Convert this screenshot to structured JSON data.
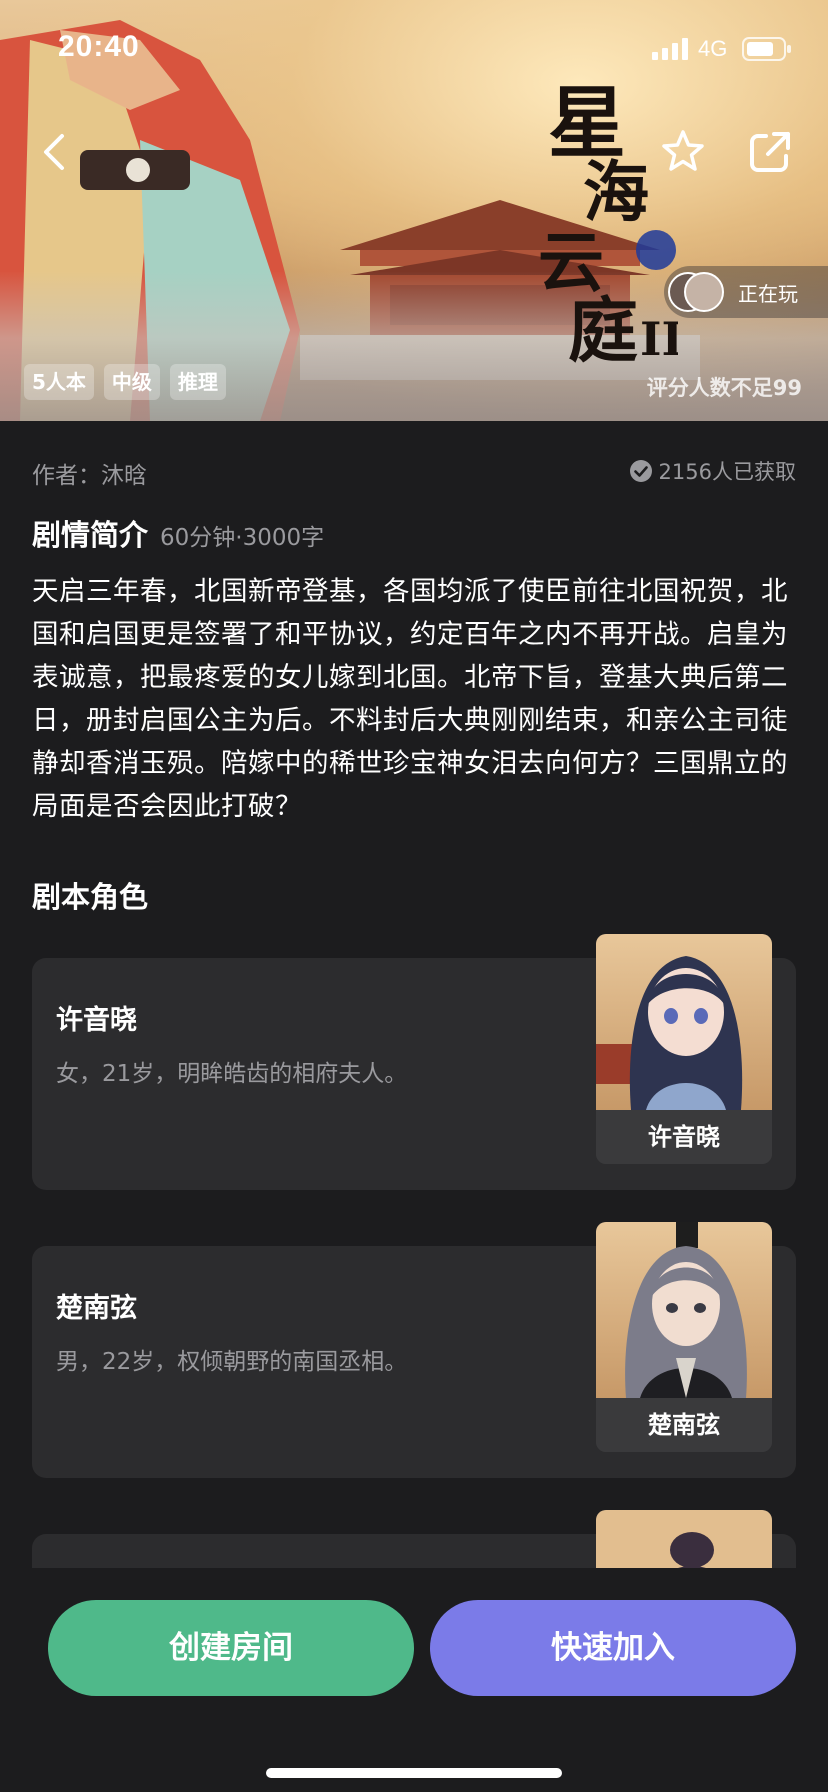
{
  "status_bar": {
    "time": "20:40",
    "network": "4G"
  },
  "header": {
    "back_icon": "chevron-left-icon",
    "favorite_icon": "star-outline-icon",
    "share_icon": "share-external-icon",
    "title_art": "星海云庭II",
    "now_playing_label": "正在玩",
    "tags": [
      "5人本",
      "中级",
      "推理"
    ],
    "rating_note": "评分人数不足99"
  },
  "info": {
    "author": "作者：沐晗",
    "obtained_count": "2156人已获取",
    "synopsis_title": "剧情简介",
    "synopsis_meta": "60分钟·3000字",
    "synopsis_text": "天启三年春，北国新帝登基，各国均派了使臣前往北国祝贺，北国和启国更是签署了和平协议，约定百年之内不再开战。启皇为表诚意，把最疼爱的女儿嫁到北国。北帝下旨，登基大典后第二日，册封启国公主为后。不料封后大典刚刚结束，和亲公主司徒静却香消玉殒。陪嫁中的稀世珍宝神女泪去向何方？三国鼎立的局面是否会因此打破？",
    "roles_title": "剧本角色"
  },
  "roles": [
    {
      "name": "许音晓",
      "desc": "女，21岁，明眸皓齿的相府夫人。",
      "caption": "许音晓"
    },
    {
      "name": "楚南弦",
      "desc": "男，22岁，权倾朝野的南国丞相。",
      "caption": "楚南弦"
    }
  ],
  "actions": {
    "create_room": "创建房间",
    "quick_join": "快速加入"
  },
  "colors": {
    "create": "#4fb98a",
    "join": "#7b7be8",
    "background": "#1c1c1e",
    "card": "#2c2c2e"
  }
}
